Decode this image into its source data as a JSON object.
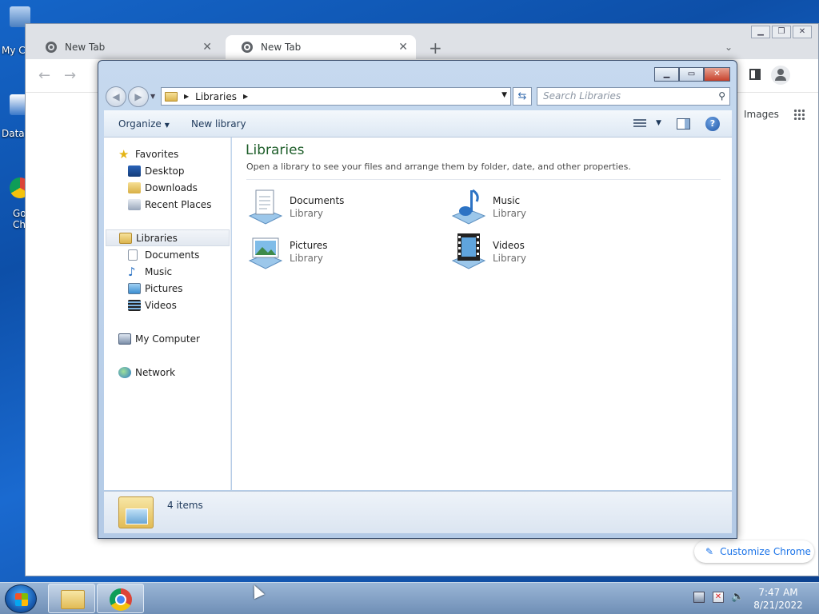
{
  "desktop": {
    "icons": [
      {
        "label": "My C"
      },
      {
        "label": "DataV"
      },
      {
        "label": "Go"
      },
      {
        "label": "Ch"
      }
    ]
  },
  "chrome": {
    "tabs": [
      {
        "label": "New Tab"
      },
      {
        "label": "New Tab"
      }
    ],
    "new_tab": "+",
    "close_glyph": "✕",
    "images_link": "Images",
    "customize_label": "Customize Chrome"
  },
  "explorer": {
    "address": "Libraries",
    "search_placeholder": "Search Libraries",
    "commands": {
      "organize": "Organize",
      "new_library": "New library"
    },
    "nav": {
      "favorites": "Favorites",
      "desktop": "Desktop",
      "downloads": "Downloads",
      "recent_places": "Recent Places",
      "libraries": "Libraries",
      "documents": "Documents",
      "music": "Music",
      "pictures": "Pictures",
      "videos": "Videos",
      "my_computer": "My Computer",
      "network": "Network"
    },
    "title": "Libraries",
    "description": "Open a library to see your files and arrange them by folder, date, and other properties.",
    "libraries": [
      {
        "name": "Documents",
        "type": "Library"
      },
      {
        "name": "Music",
        "type": "Library"
      },
      {
        "name": "Pictures",
        "type": "Library"
      },
      {
        "name": "Videos",
        "type": "Library"
      }
    ],
    "item_count": "4 items"
  },
  "taskbar": {
    "time": "7:47 AM",
    "date": "8/21/2022"
  }
}
